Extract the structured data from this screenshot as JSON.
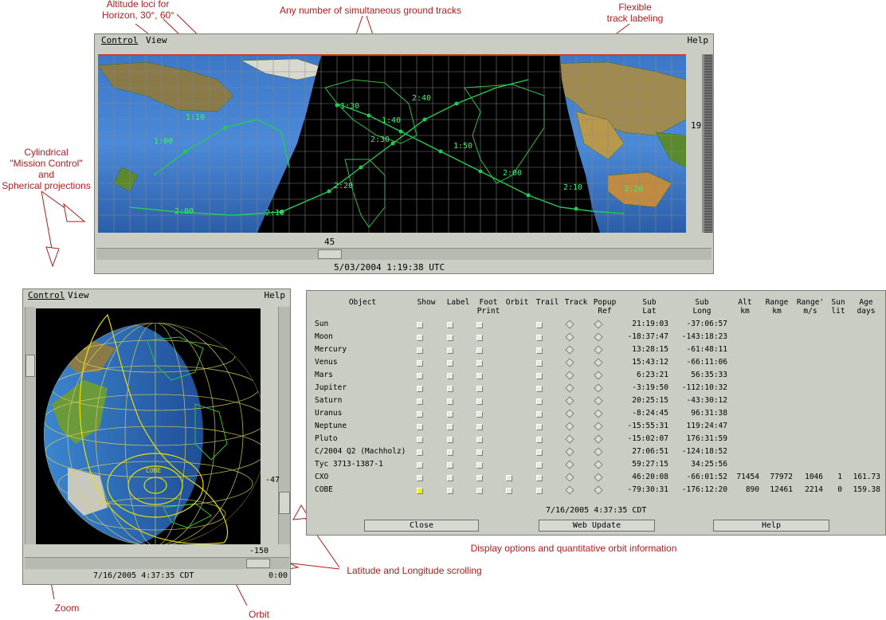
{
  "annotations": {
    "altitude_loci": "Altitude loci for\nHorizon, 30°, 60°",
    "ground_tracks": "Any number of simultaneous ground tracks",
    "flexible_label": "Flexible\ntrack labeling",
    "projections": "Cylindrical\n\"Mission Control\"\nand\nSpherical projections",
    "display_options": "Display options and quantitative orbit information",
    "lat_long": "Latitude and Longitude scrolling",
    "zoom": "Zoom",
    "orbit": "Orbit"
  },
  "map_window": {
    "menu_control": "Control",
    "menu_view": "View",
    "menu_help": "Help",
    "side_value": "19",
    "bottom_value": "45",
    "status": "5/03/2004   1:19:38 UTC",
    "track_labels": [
      "1:30",
      "1:40",
      "1:50",
      "2:00",
      "2:10",
      "2:20",
      "2:30",
      "2:40",
      "1:00",
      "1:10",
      "2:10",
      "2:00",
      "2:20"
    ]
  },
  "globe_window": {
    "menu_control": "Control",
    "menu_view": "View",
    "menu_help": "Help",
    "side_value": "-47",
    "bottom_value": "-150",
    "status": "7/16/2005   4:37:35 CDT",
    "corner": "0:00",
    "object_label": "COBE"
  },
  "table": {
    "headers": [
      "Object",
      "Show",
      "Label",
      "Foot\nPrint",
      "Orbit",
      "Trail",
      "Track",
      "Popup\nRef",
      "Sub\nLat",
      "Sub\nLong",
      "Alt\nkm",
      "Range\nkm",
      "Range'\nm/s",
      "Sun\nlit",
      "Age\ndays"
    ],
    "rows": [
      {
        "name": "Sun",
        "lat": "21:19:03",
        "long": "-37:06:57",
        "alt": "",
        "range": "",
        "rate": "",
        "sunlit": "",
        "age": ""
      },
      {
        "name": "Moon",
        "lat": "-18:37:47",
        "long": "-143:18:23",
        "alt": "",
        "range": "",
        "rate": "",
        "sunlit": "",
        "age": ""
      },
      {
        "name": "Mercury",
        "lat": "13:28:15",
        "long": "-61:48:11",
        "alt": "",
        "range": "",
        "rate": "",
        "sunlit": "",
        "age": ""
      },
      {
        "name": "Venus",
        "lat": "15:43:12",
        "long": "-66:11:06",
        "alt": "",
        "range": "",
        "rate": "",
        "sunlit": "",
        "age": ""
      },
      {
        "name": "Mars",
        "lat": "6:23:21",
        "long": "56:35:33",
        "alt": "",
        "range": "",
        "rate": "",
        "sunlit": "",
        "age": ""
      },
      {
        "name": "Jupiter",
        "lat": "-3:19:50",
        "long": "-112:10:32",
        "alt": "",
        "range": "",
        "rate": "",
        "sunlit": "",
        "age": ""
      },
      {
        "name": "Saturn",
        "lat": "20:25:15",
        "long": "-43:30:12",
        "alt": "",
        "range": "",
        "rate": "",
        "sunlit": "",
        "age": ""
      },
      {
        "name": "Uranus",
        "lat": "-8:24:45",
        "long": "96:31:38",
        "alt": "",
        "range": "",
        "rate": "",
        "sunlit": "",
        "age": ""
      },
      {
        "name": "Neptune",
        "lat": "-15:55:31",
        "long": "119:24:47",
        "alt": "",
        "range": "",
        "rate": "",
        "sunlit": "",
        "age": ""
      },
      {
        "name": "Pluto",
        "lat": "-15:02:07",
        "long": "176:31:59",
        "alt": "",
        "range": "",
        "rate": "",
        "sunlit": "",
        "age": ""
      },
      {
        "name": "C/2004 Q2 (Machholz)",
        "lat": "27:06:51",
        "long": "-124:18:52",
        "alt": "",
        "range": "",
        "rate": "",
        "sunlit": "",
        "age": ""
      },
      {
        "name": "Tyc 3713-1387-1",
        "lat": "59:27:15",
        "long": "34:25:56",
        "alt": "",
        "range": "",
        "rate": "",
        "sunlit": "",
        "age": ""
      },
      {
        "name": "CXO",
        "lat": "46:20:08",
        "long": "-66:01:52",
        "alt": "71454",
        "range": "77972",
        "rate": "1046",
        "sunlit": "1",
        "age": "161.73"
      },
      {
        "name": "COBE",
        "lat": "-79:30:31",
        "long": "-176:12:20",
        "alt": "890",
        "range": "12461",
        "rate": "2214",
        "sunlit": "0",
        "age": "159.38"
      }
    ],
    "timestamp": "7/16/2005   4:37:35 CDT",
    "close_label": "Close",
    "web_update_label": "Web Update",
    "help_label": "Help"
  },
  "colors": {
    "window_bg": "#c9cdc4",
    "annotation": "#b01c1c",
    "track": "#22cc55",
    "orbit": "#e8e000",
    "night": "#000000"
  }
}
